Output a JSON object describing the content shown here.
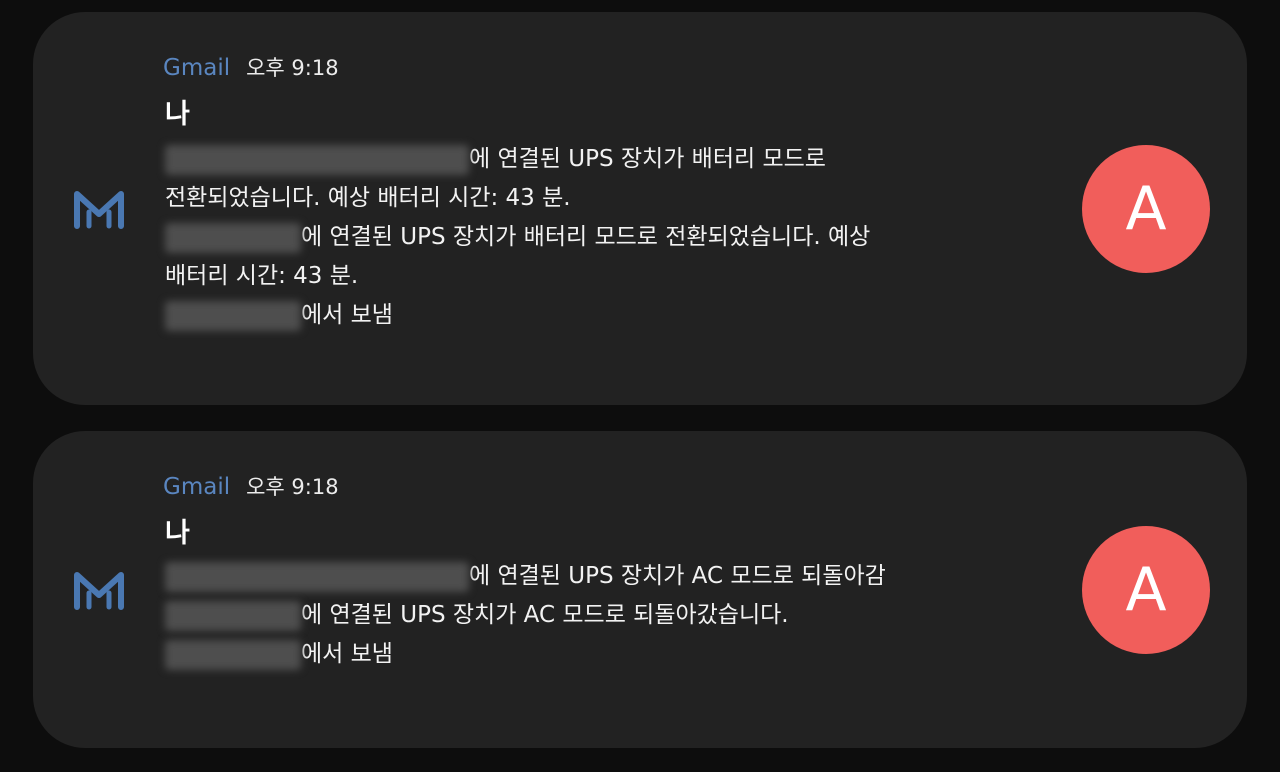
{
  "colors": {
    "background": "#0d0d0d",
    "card": "#222222",
    "app_name": "#5a86c0",
    "avatar": "#f15e5b",
    "text": "#f2f2f2"
  },
  "notifications": [
    {
      "app_icon": "gmail-icon",
      "app_name": "Gmail",
      "time": "오후 9:18",
      "sender": "나",
      "avatar_letter": "A",
      "lines": [
        "에 연결된 UPS 장치가 배터리 모드로",
        "전환되었습니다. 예상 배터리 시간: 43 분.",
        "에 연결된 UPS 장치가 배터리 모드로 전환되었습니다. 예상",
        "배터리 시간: 43 분.",
        "에서 보냄"
      ]
    },
    {
      "app_icon": "gmail-icon",
      "app_name": "Gmail",
      "time": "오후 9:18",
      "sender": "나",
      "avatar_letter": "A",
      "lines": [
        "에 연결된 UPS 장치가 AC 모드로 되돌아감",
        "에 연결된 UPS 장치가 AC 모드로 되돌아갔습니다.",
        "에서 보냄"
      ]
    }
  ]
}
